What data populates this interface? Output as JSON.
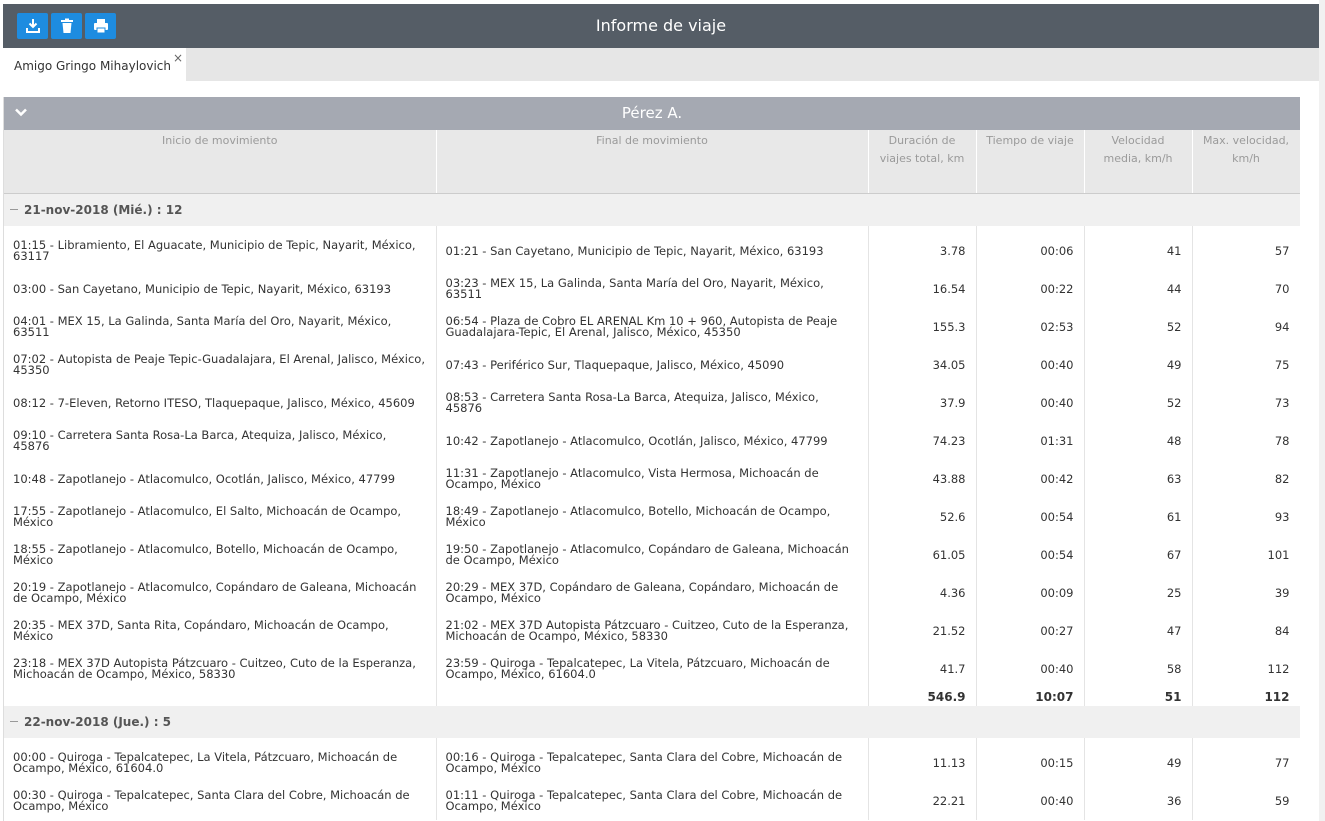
{
  "toolbar": {
    "title": "Informe de viaje",
    "buttons": [
      "download-icon",
      "trash-icon",
      "print-icon"
    ],
    "accent": "#1e8ce0",
    "bar_color": "#555d66"
  },
  "tabs": [
    {
      "label": "Amigo Gringo Mihaylovich",
      "close": "×"
    }
  ],
  "panel": {
    "title": "Pérez A.",
    "header_color": "#a5a9b2"
  },
  "columns": [
    "Inicio de movimiento",
    "Final de movimiento",
    "Duración de viajes total, km",
    "Tiempo de viaje",
    "Velocidad media, km/h",
    "Max. velocidad, km/h"
  ],
  "groups": [
    {
      "label": "21-nov-2018 (Mié.) : 12",
      "rows": [
        [
          "01:15 - Libramiento, El Aguacate, Municipio de Tepic, Nayarit, México, 63117",
          "01:21 - San Cayetano, Municipio de Tepic, Nayarit, México, 63193",
          "3.78",
          "00:06",
          "41",
          "57"
        ],
        [
          "03:00 - San Cayetano, Municipio de Tepic, Nayarit, México, 63193",
          "03:23 - MEX 15, La Galinda, Santa María del Oro, Nayarit, México, 63511",
          "16.54",
          "00:22",
          "44",
          "70"
        ],
        [
          "04:01 - MEX 15, La Galinda, Santa María del Oro, Nayarit, México, 63511",
          "06:54 - Plaza de Cobro EL ARENAL Km 10 + 960, Autopista de Peaje Guadalajara-Tepic, El Arenal, Jalisco, México, 45350",
          "155.3",
          "02:53",
          "52",
          "94"
        ],
        [
          "07:02 - Autopista de Peaje Tepic-Guadalajara, El Arenal, Jalisco, México, 45350",
          "07:43 - Periférico Sur, Tlaquepaque, Jalisco, México, 45090",
          "34.05",
          "00:40",
          "49",
          "75"
        ],
        [
          "08:12 - 7-Eleven, Retorno ITESO, Tlaquepaque, Jalisco, México, 45609",
          "08:53 - Carretera Santa Rosa-La Barca, Atequiza, Jalisco, México, 45876",
          "37.9",
          "00:40",
          "52",
          "73"
        ],
        [
          "09:10 - Carretera Santa Rosa-La Barca, Atequiza, Jalisco, México, 45876",
          "10:42 - Zapotlanejo - Atlacomulco, Ocotlán, Jalisco, México, 47799",
          "74.23",
          "01:31",
          "48",
          "78"
        ],
        [
          "10:48 - Zapotlanejo - Atlacomulco, Ocotlán, Jalisco, México, 47799",
          "11:31 - Zapotlanejo - Atlacomulco, Vista Hermosa, Michoacán de Ocampo, México",
          "43.88",
          "00:42",
          "63",
          "82"
        ],
        [
          "17:55 - Zapotlanejo - Atlacomulco, El Salto, Michoacán de Ocampo, México",
          "18:49 - Zapotlanejo - Atlacomulco, Botello, Michoacán de Ocampo, México",
          "52.6",
          "00:54",
          "61",
          "93"
        ],
        [
          "18:55 - Zapotlanejo - Atlacomulco, Botello, Michoacán de Ocampo, México",
          "19:50 - Zapotlanejo - Atlacomulco, Copándaro de Galeana, Michoacán de Ocampo, México",
          "61.05",
          "00:54",
          "67",
          "101"
        ],
        [
          "20:19 - Zapotlanejo - Atlacomulco, Copándaro de Galeana, Michoacán de Ocampo, México",
          "20:29 - MEX 37D, Copándaro de Galeana, Copándaro, Michoacán de Ocampo, México",
          "4.36",
          "00:09",
          "25",
          "39"
        ],
        [
          "20:35 - MEX 37D, Santa Rita, Copándaro, Michoacán de Ocampo, México",
          "21:02 - MEX 37D Autopista Pátzcuaro - Cuitzeo, Cuto de la Esperanza, Michoacán de Ocampo, México, 58330",
          "21.52",
          "00:27",
          "47",
          "84"
        ],
        [
          "23:18 - MEX 37D Autopista Pátzcuaro - Cuitzeo, Cuto de la Esperanza, Michoacán de Ocampo, México, 58330",
          "23:59 - Quiroga - Tepalcatepec, La Vitela, Pátzcuaro, Michoacán de Ocampo, México, 61604.0",
          "41.7",
          "00:40",
          "58",
          "112"
        ]
      ],
      "total": [
        "546.9",
        "10:07",
        "51",
        "112"
      ]
    },
    {
      "label": "22-nov-2018 (Jue.) : 5",
      "rows": [
        [
          "00:00 - Quiroga - Tepalcatepec, La Vitela, Pátzcuaro, Michoacán de Ocampo, México, 61604.0",
          "00:16 - Quiroga - Tepalcatepec, Santa Clara del Cobre, Michoacán de Ocampo, México",
          "11.13",
          "00:15",
          "49",
          "77"
        ],
        [
          "00:30 - Quiroga - Tepalcatepec, Santa Clara del Cobre, Michoacán de Ocampo, México",
          "01:11 - Quiroga - Tepalcatepec, Santa Clara del Cobre, Michoacán de Ocampo, México",
          "22.21",
          "00:40",
          "36",
          "59"
        ]
      ]
    }
  ]
}
